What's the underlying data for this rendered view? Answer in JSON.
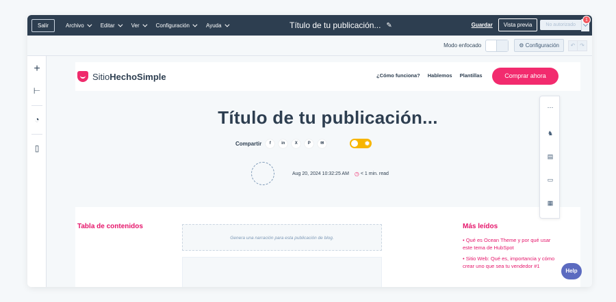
{
  "topbar": {
    "exit_label": "Salir",
    "menu": [
      {
        "label": "Archivo"
      },
      {
        "label": "Editar"
      },
      {
        "label": "Ver"
      },
      {
        "label": "Configuración"
      },
      {
        "label": "Ayuda"
      }
    ],
    "post_title": "Título de tu publicación...",
    "save_label": "Guardar",
    "preview_label": "Vista previa",
    "unauthorized_label": "No autorizado",
    "notification_count": "1"
  },
  "toolbar": {
    "focus_mode_label": "Modo enfocado",
    "config_label": "Configuración",
    "icons": {
      "undo": "undo-icon",
      "redo": "redo-icon",
      "gear": "gear-icon"
    }
  },
  "site": {
    "logo_regular": "Sitio",
    "logo_bold": "HechoSimple",
    "nav": [
      "¿Cómo funciona?",
      "Hablemos",
      "Plantillas"
    ],
    "cta_label": "Comprar ahora",
    "brand_color": "#f22b6e"
  },
  "hero": {
    "title": "Título de tu publicación...",
    "share_label": "Compartir",
    "share_icons": [
      "f",
      "in",
      "X",
      "P",
      "✉"
    ],
    "date": "Aug 20, 2024 10:32:25 AM",
    "read_time": "< 1 min. read"
  },
  "body": {
    "toc_title": "Tabla de contenidos",
    "narration_placeholder": "Genera una narración para esta publicación de blog.",
    "more_title": "Más leídos",
    "more_items": [
      "Qué es Ocean Theme y por qué usar este tema de HubSpot",
      "Sitio Web: Qué es, importancia y cómo crear uno que sea tu vendedor #1"
    ]
  },
  "help_label": "Help"
}
